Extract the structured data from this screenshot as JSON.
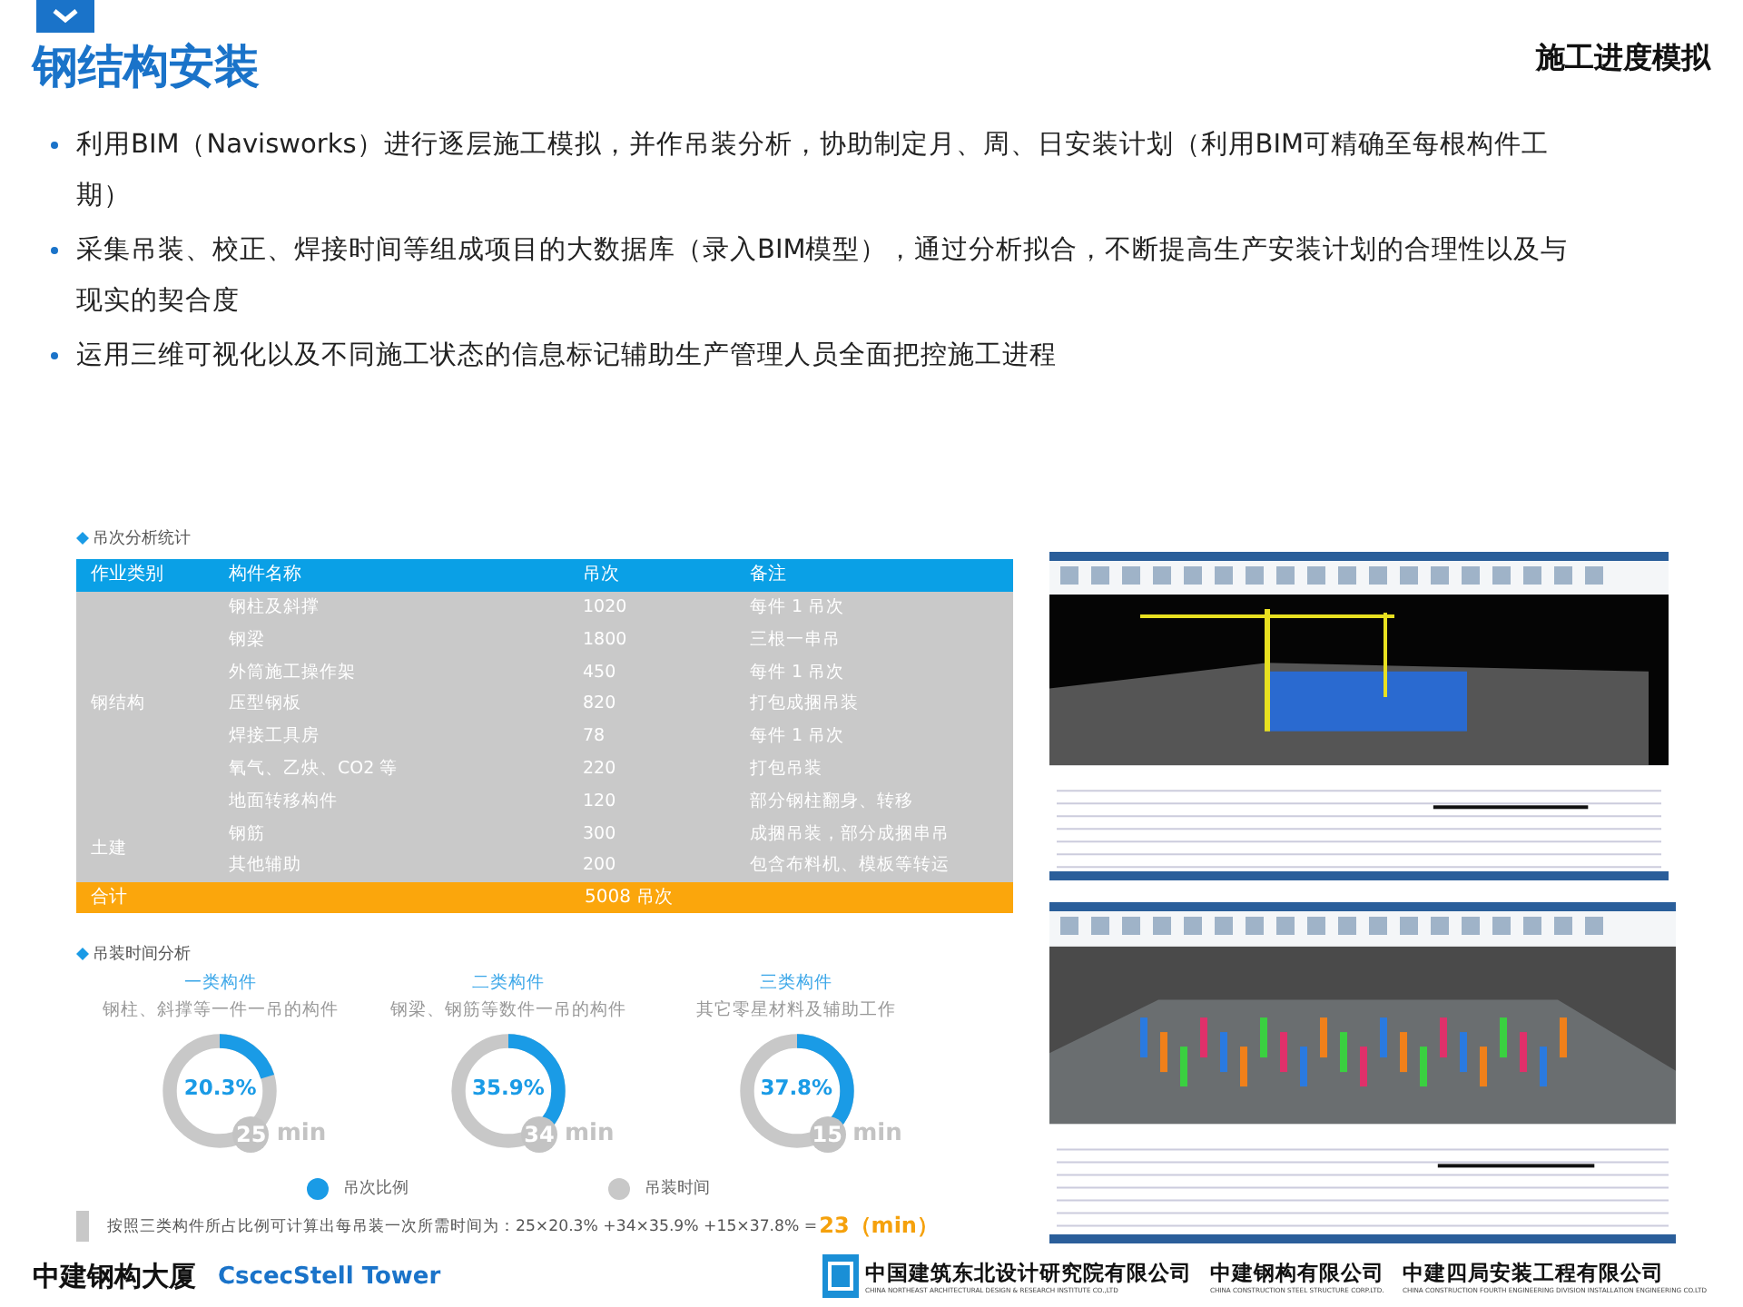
{
  "header": {
    "title": "钢结构安装",
    "subtitle": "施工进度模拟"
  },
  "bullets": [
    "利用BIM（Navisworks）进行逐层施工模拟，并作吊装分析，协助制定月、周、日安装计划（利用BIM可精确至每根构件工期）",
    "采集吊装、校正、焊接时间等组成项目的大数据库（录入BIM模型），通过分析拟合，不断提高生产安装计划的合理性以及与现实的契合度",
    "运用三维可视化以及不同施工状态的信息标记辅助生产管理人员全面把控施工进程"
  ],
  "lift_table": {
    "title": "吊次分析统计",
    "columns": [
      "作业类别",
      "构件名称",
      "吊次",
      "备注"
    ],
    "groups": [
      {
        "category": "钢结构",
        "rows": [
          {
            "name": "钢柱及斜撑",
            "lifts": "1020",
            "note": "每件 1 吊次"
          },
          {
            "name": "钢梁",
            "lifts": "1800",
            "note": "三根一串吊"
          },
          {
            "name": "外筒施工操作架",
            "lifts": "450",
            "note": "每件 1 吊次"
          },
          {
            "name": "压型钢板",
            "lifts": "820",
            "note": "打包成捆吊装"
          },
          {
            "name": "焊接工具房",
            "lifts": "78",
            "note": "每件 1 吊次"
          },
          {
            "name": "氧气、乙炔、CO2 等",
            "lifts": "220",
            "note": "打包吊装"
          },
          {
            "name": "地面转移构件",
            "lifts": "120",
            "note": "部分钢柱翻身、转移"
          }
        ]
      },
      {
        "category": "土建",
        "rows": [
          {
            "name": "钢筋",
            "lifts": "300",
            "note": "成捆吊装，部分成捆串吊"
          },
          {
            "name": "其他辅助",
            "lifts": "200",
            "note": "包含布料机、模板等转运"
          }
        ]
      }
    ],
    "total": {
      "label": "合计",
      "value": "5008 吊次"
    }
  },
  "time_analysis": {
    "title": "吊装时间分析",
    "classes": [
      {
        "name": "一类构件",
        "description": "钢柱、斜撑等一件一吊的构件",
        "share": "20.3%",
        "level": 0.203,
        "minutes": "25",
        "unit": "min"
      },
      {
        "name": "二类构件",
        "description": "钢梁、钢筋等数件一吊的构件",
        "share": "35.9%",
        "level": 0.359,
        "minutes": "34",
        "unit": "min"
      },
      {
        "name": "三类构件",
        "description": "其它零星材料及辅助工作",
        "share": "37.8%",
        "level": 0.378,
        "minutes": "15",
        "unit": "min"
      }
    ],
    "legend": [
      {
        "label": "吊次比例",
        "color": "#1a9be6"
      },
      {
        "label": "吊装时间",
        "color": "#c8c8c8"
      }
    ],
    "formula": "按照三类构件所占比例可计算出每吊装一次所需时间为：25×20.3% +34×35.9% +15×37.8% =",
    "result": "23（min）"
  },
  "footer": {
    "project": "中建钢构大厦",
    "project_en": "CscecStell Tower",
    "companies": [
      {
        "name": "中国建筑东北设计研究院有限公司",
        "name_en": "CHINA NORTHEAST ARCHITECTURAL DESIGN & RESEARCH INSTITUTE CO.,LTD"
      },
      {
        "name": "中建钢构有限公司",
        "name_en": "CHINA CONSTRUCTION STEEL STRUCTURE CORP.LTD."
      },
      {
        "name": "中建四局安装工程有限公司",
        "name_en": "CHINA CONSTRUCTION FOURTH ENGINEERING DIVISION INSTALLATION ENGINEERING CO.LTD"
      }
    ]
  }
}
